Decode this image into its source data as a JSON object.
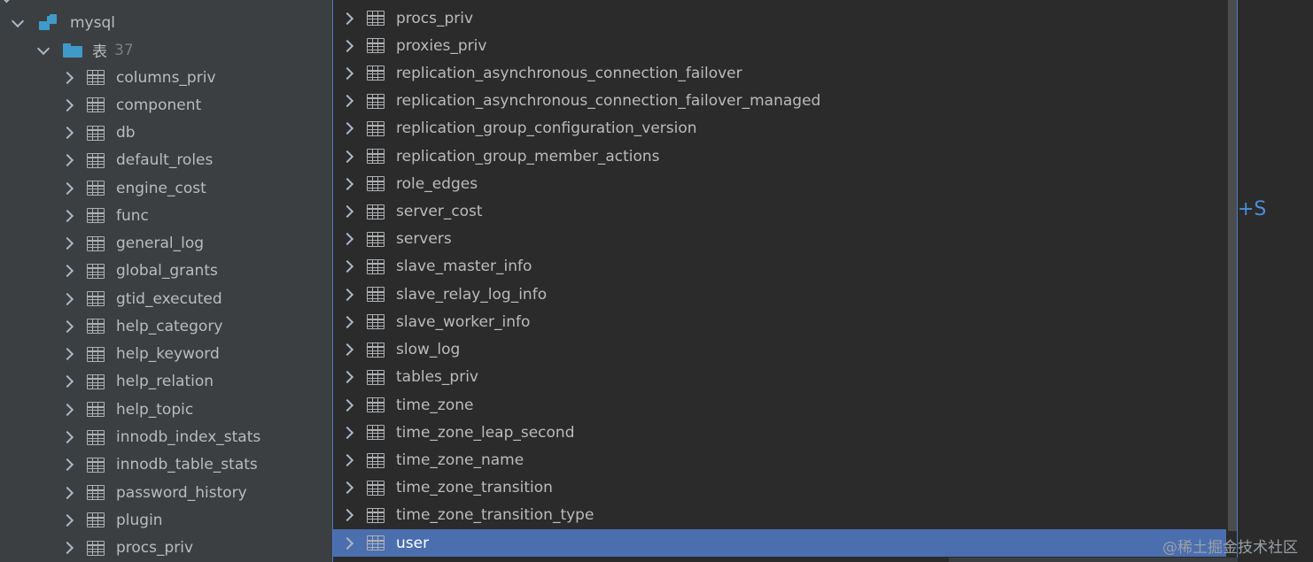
{
  "left_tree": {
    "top_partial_text": "· · ·",
    "database": {
      "label": "mysql"
    },
    "folder": {
      "label": "表",
      "count": "37"
    },
    "tables": [
      "columns_priv",
      "component",
      "db",
      "default_roles",
      "engine_cost",
      "func",
      "general_log",
      "global_grants",
      "gtid_executed",
      "help_category",
      "help_keyword",
      "help_relation",
      "help_topic",
      "innodb_index_stats",
      "innodb_table_stats",
      "password_history",
      "plugin",
      "procs_priv"
    ]
  },
  "right_list": {
    "tables": [
      "procs_priv",
      "proxies_priv",
      "replication_asynchronous_connection_failover",
      "replication_asynchronous_connection_failover_managed",
      "replication_group_configuration_version",
      "replication_group_member_actions",
      "role_edges",
      "server_cost",
      "servers",
      "slave_master_info",
      "slave_relay_log_info",
      "slave_worker_info",
      "slow_log",
      "tables_priv",
      "time_zone",
      "time_zone_leap_second",
      "time_zone_name",
      "time_zone_transition",
      "time_zone_transition_type",
      "user"
    ],
    "selected": "user"
  },
  "side_text": "+S",
  "watermark": "@稀土掘金技术社区",
  "colors": {
    "selection": "#4b6eaf",
    "accent": "#3f9ac9",
    "link": "#4a8fe0"
  }
}
